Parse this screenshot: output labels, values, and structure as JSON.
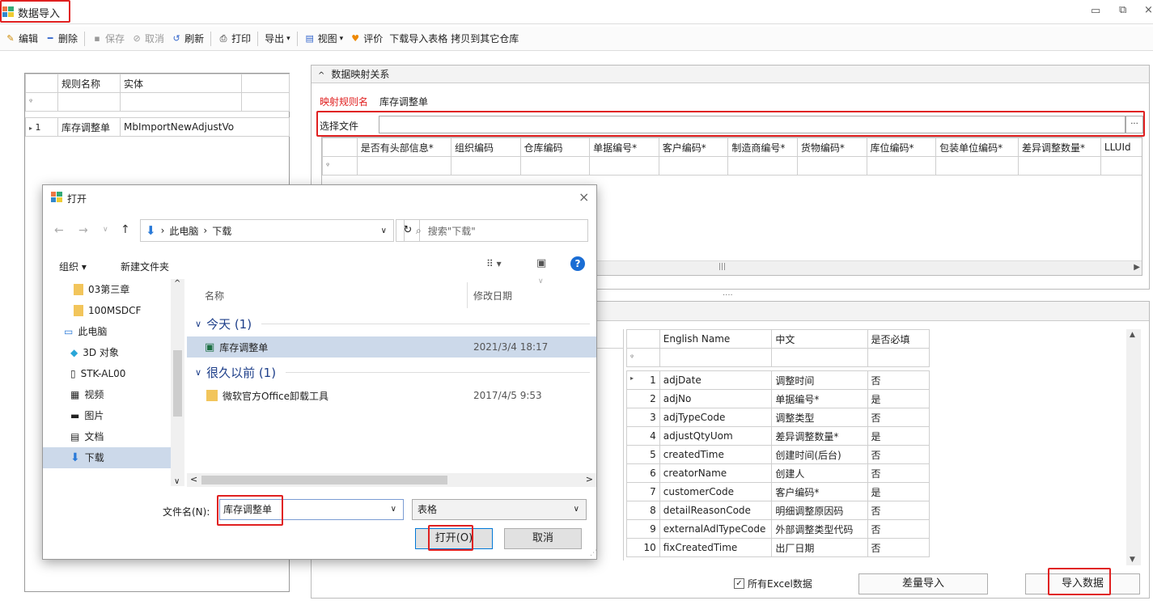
{
  "window": {
    "title": "数据导入"
  },
  "toolbar": {
    "edit": "编辑",
    "delete": "删除",
    "save": "保存",
    "cancel": "取消",
    "refresh": "刷新",
    "print": "打印",
    "export": "导出",
    "view": "视图",
    "rate": "评价",
    "download_template": "下载导入表格",
    "copy_to": "拷贝到其它仓库"
  },
  "rules_grid": {
    "headers": [
      "规则名称",
      "实体"
    ],
    "rows": [
      {
        "num": "1",
        "name": "库存调整单",
        "entity": "MbImportNewAdjustVo"
      }
    ]
  },
  "mapping": {
    "group_title": "数据映射关系",
    "rule_label": "映射规则名",
    "rule_value": "库存调整单",
    "select_file_label": "选择文件",
    "browse_btn": "···",
    "columns": [
      "是否有头部信息*",
      "组织编码",
      "仓库编码",
      "单据编号*",
      "客户编码*",
      "制造商编号*",
      "货物编码*",
      "库位编码*",
      "包装单位编码*",
      "差异调整数量*",
      "LLUId"
    ]
  },
  "fields_grid": {
    "headers": [
      "English Name",
      "中文",
      "是否必填"
    ],
    "rows": [
      {
        "num": "1",
        "en": "adjDate",
        "cn": "调整时间",
        "req": "否"
      },
      {
        "num": "2",
        "en": "adjNo",
        "cn": "单据编号*",
        "req": "是"
      },
      {
        "num": "3",
        "en": "adjTypeCode",
        "cn": "调整类型",
        "req": "否"
      },
      {
        "num": "4",
        "en": "adjustQtyUom",
        "cn": "差异调整数量*",
        "req": "是"
      },
      {
        "num": "5",
        "en": "createdTime",
        "cn": "创建时间(后台)",
        "req": "否"
      },
      {
        "num": "6",
        "en": "creatorName",
        "cn": "创建人",
        "req": "否"
      },
      {
        "num": "7",
        "en": "customerCode",
        "cn": "客户编码*",
        "req": "是"
      },
      {
        "num": "8",
        "en": "detailReasonCode",
        "cn": "明细调整原因码",
        "req": "否"
      },
      {
        "num": "9",
        "en": "externalAdlTypeCode",
        "cn": "外部调整类型代码",
        "req": "否"
      },
      {
        "num": "10",
        "en": "fixCreatedTime",
        "cn": "出厂日期",
        "req": "否"
      }
    ]
  },
  "bottom": {
    "all_excel": "所有Excel数据",
    "diff_import": "差量导入",
    "import_data": "导入数据"
  },
  "dialog": {
    "title": "打开",
    "path": [
      "此电脑",
      "下载"
    ],
    "search_placeholder": "搜索\"下载\"",
    "organize": "组织 ▾",
    "new_folder": "新建文件夹",
    "nav_items": [
      "03第三章",
      "100MSDCF",
      "此电脑",
      "3D 对象",
      "STK-AL00",
      "视频",
      "图片",
      "文档",
      "下载"
    ],
    "col_name": "名称",
    "col_date": "修改日期",
    "group_today": "今天 (1)",
    "group_old": "很久以前 (1)",
    "files": [
      {
        "name": "库存调整单",
        "date": "2021/3/4 18:17"
      },
      {
        "name": "微软官方Office卸载工具",
        "date": "2017/4/5 9:53"
      }
    ],
    "filename_label": "文件名(N):",
    "filename_value": "库存调整单",
    "filetype_value": "表格",
    "open_btn": "打开(O)",
    "cancel_btn": "取消"
  }
}
